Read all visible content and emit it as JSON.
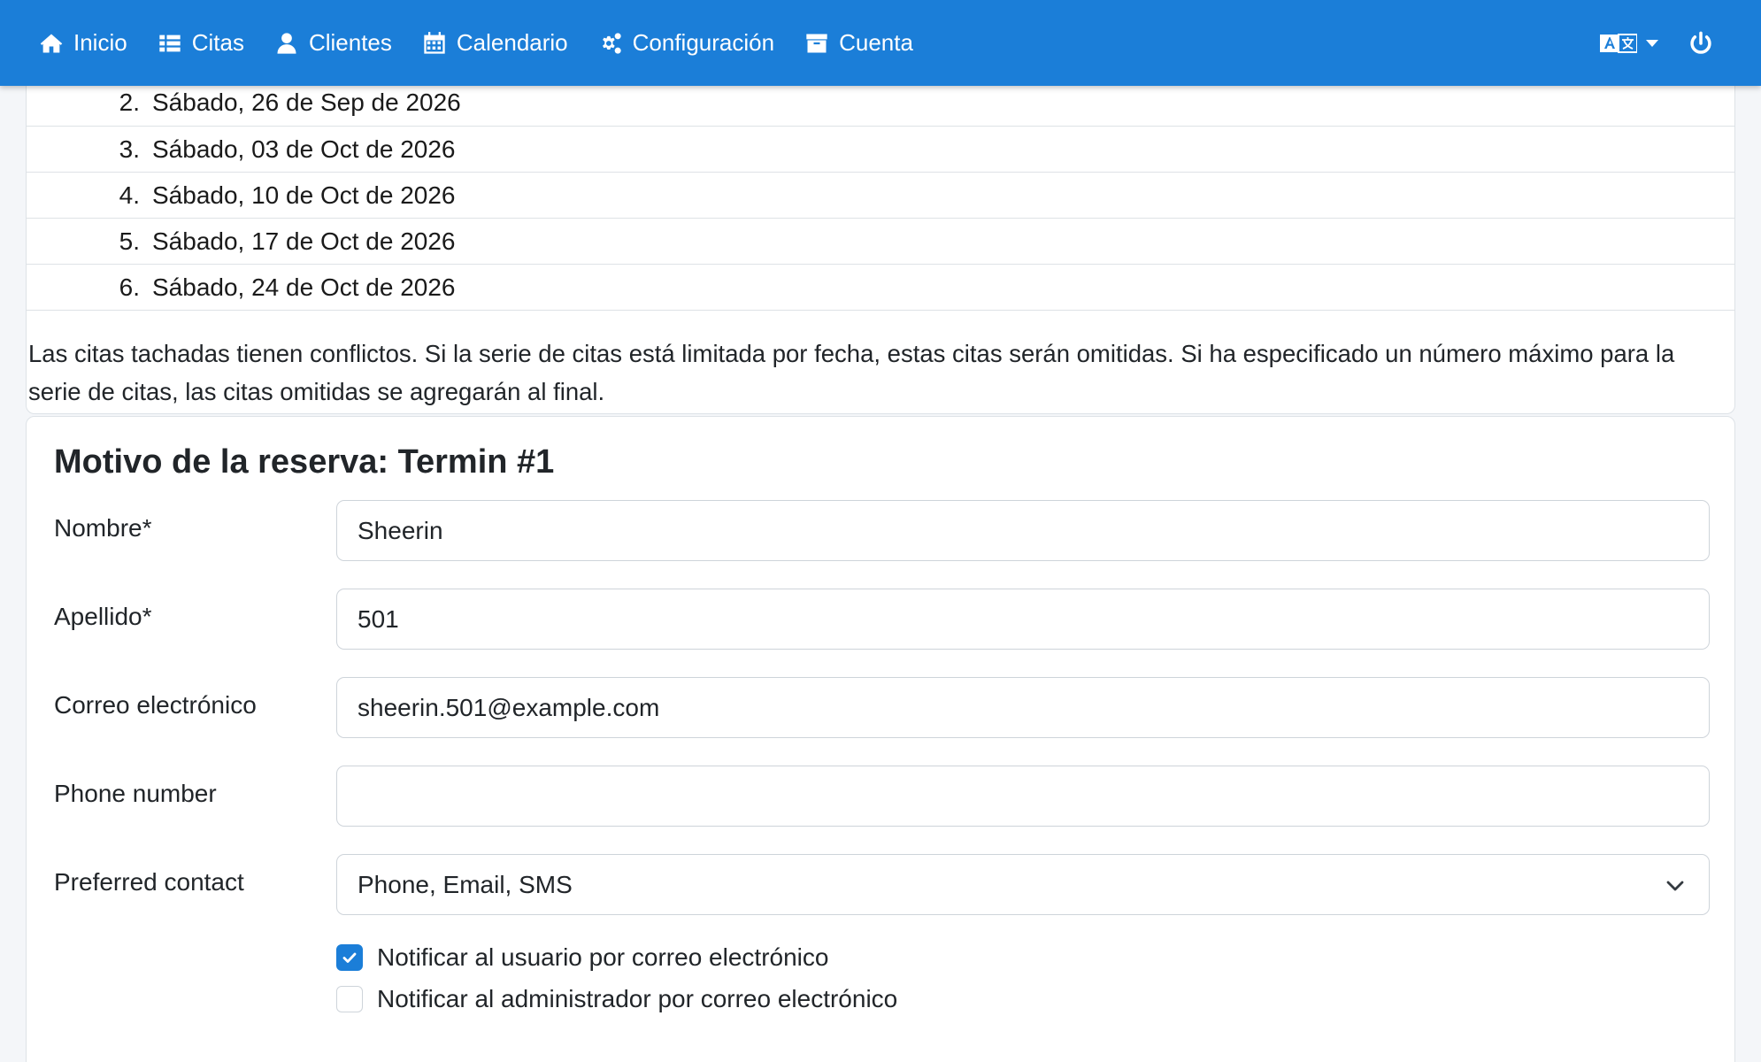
{
  "nav": {
    "items": [
      {
        "label": "Inicio",
        "icon": "home-icon"
      },
      {
        "label": "Citas",
        "icon": "list-icon"
      },
      {
        "label": "Clientes",
        "icon": "user-icon"
      },
      {
        "label": "Calendario",
        "icon": "calendar-icon"
      },
      {
        "label": "Configuración",
        "icon": "gears-icon"
      },
      {
        "label": "Cuenta",
        "icon": "archive-icon"
      }
    ],
    "language_icon": "translate-icon",
    "logout_icon": "power-icon",
    "colors": {
      "bar": "#1b7ed8",
      "text": "#ffffff"
    }
  },
  "appointments": {
    "dates": [
      {
        "num": "2.",
        "text": "Sábado, 26 de Sep de 2026"
      },
      {
        "num": "3.",
        "text": "Sábado, 03 de Oct de 2026"
      },
      {
        "num": "4.",
        "text": "Sábado, 10 de Oct de 2026"
      },
      {
        "num": "5.",
        "text": "Sábado, 17 de Oct de 2026"
      },
      {
        "num": "6.",
        "text": "Sábado, 24 de Oct de 2026"
      }
    ],
    "conflict_note": "Las citas tachadas tienen conflictos. Si la serie de citas está limitada por fecha, estas citas serán omitidas. Si ha especificado un número máximo para la serie de citas, las citas omitidas se agregarán al final."
  },
  "form": {
    "title": "Motivo de la reserva: Termin #1",
    "fields": {
      "first_name": {
        "label": "Nombre*",
        "value": "Sheerin"
      },
      "last_name": {
        "label": "Apellido*",
        "value": "501"
      },
      "email": {
        "label": "Correo electrónico",
        "value": "sheerin.501@example.com"
      },
      "phone": {
        "label": "Phone number",
        "value": ""
      },
      "preferred_contact": {
        "label": "Preferred contact",
        "value": "Phone, Email, SMS"
      }
    },
    "checkboxes": {
      "notify_user": {
        "label": "Notificar al usuario por correo electrónico",
        "checked": true
      },
      "notify_admin": {
        "label": "Notificar al administrador por correo electrónico",
        "checked": false
      }
    },
    "accent_color": "#1b7ed8"
  }
}
